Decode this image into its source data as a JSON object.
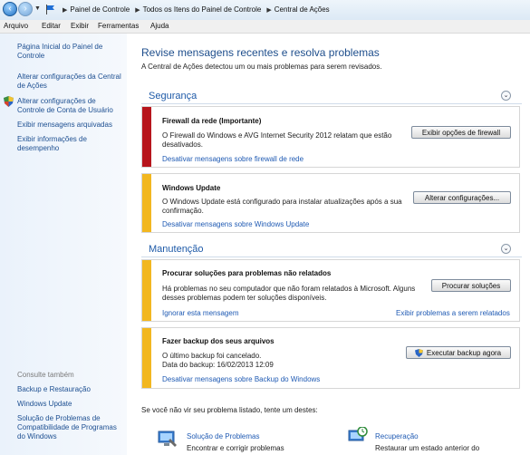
{
  "breadcrumb": [
    "Painel de Controle",
    "Todos os Itens do Painel de Controle",
    "Central de Ações"
  ],
  "menu": [
    "Arquivo",
    "Editar",
    "Exibir",
    "Ferramentas",
    "Ajuda"
  ],
  "sidebar": {
    "links": [
      "Página Inicial do Painel de Controle",
      "Alterar configurações da Central de Ações",
      "Alterar configurações de Controle de Conta de Usuário",
      "Exibir mensagens arquivadas",
      "Exibir informações de desempenho"
    ],
    "see_also_title": "Consulte também",
    "see_also": [
      "Backup e Restauração",
      "Windows Update",
      "Solução de Problemas de Compatibilidade de Programas do Windows"
    ]
  },
  "main": {
    "title": "Revise mensagens recentes e resolva problemas",
    "subtitle": "A Central de Ações detectou um ou mais problemas para serem revisados.",
    "security": {
      "title": "Segurança",
      "cards": [
        {
          "title": "Firewall da rede  (Importante)",
          "body": "O Firewall do Windows e AVG Internet Security 2012 relatam que estão desativados.",
          "link": "Desativar mensagens sobre firewall de rede",
          "button": "Exibir opções de firewall"
        },
        {
          "title": "Windows Update",
          "body": "O Windows Update está configurado para instalar atualizações após a sua confirmação.",
          "link": "Desativar mensagens sobre Windows Update",
          "button": "Alterar configurações..."
        }
      ]
    },
    "maintenance": {
      "title": "Manutenção",
      "cards": [
        {
          "title": "Procurar soluções para problemas não relatados",
          "body": "Há problemas no seu computador que não foram relatados à Microsoft. Alguns desses problemas podem ter soluções disponíveis.",
          "link": "Ignorar esta mensagem",
          "link2": "Exibir problemas a serem relatados",
          "button": "Procurar soluções"
        },
        {
          "title": "Fazer backup dos seus arquivos",
          "body": "O último backup foi cancelado.",
          "body2": "Data do backup: 16/02/2013 12:09",
          "link": "Desativar mensagens sobre Backup do Windows",
          "button": "Executar backup agora"
        }
      ]
    },
    "try_text": "Se você não vir seu problema listado, tente um destes:",
    "bottom": [
      {
        "link": "Solução de Problemas",
        "desc": "Encontrar e corrigir problemas"
      },
      {
        "link": "Recuperação",
        "desc": "Restaurar um estado anterior do"
      }
    ]
  },
  "colors": {
    "critical": "#b7151c",
    "warning": "#f2b720",
    "link": "#1f5ab3",
    "heading": "#1e4e8c"
  },
  "icons": [
    "back-icon",
    "forward-icon",
    "dropdown-icon",
    "flag-icon",
    "uac-shield-icon",
    "chevron-down-icon",
    "backup-shield-icon",
    "troubleshoot-icon",
    "recovery-icon"
  ]
}
